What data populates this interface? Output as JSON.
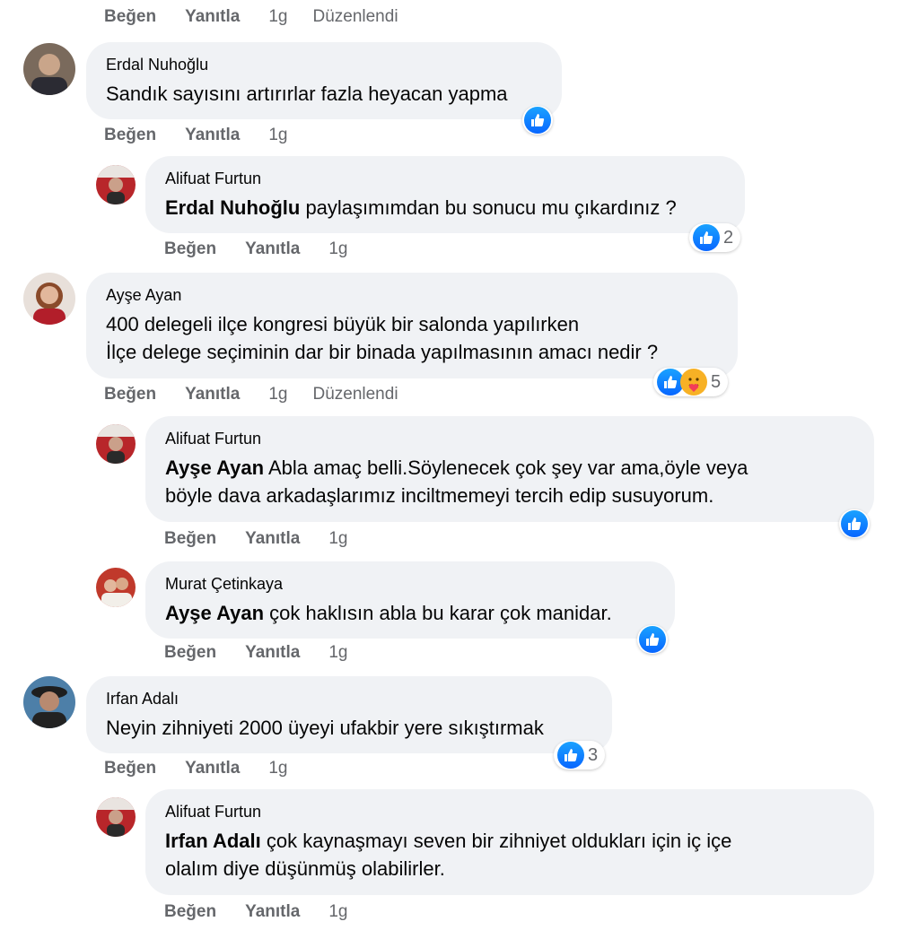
{
  "actions": {
    "like": "Beğen",
    "reply": "Yanıtla",
    "time": "1g",
    "edited": "Düzenlendi"
  },
  "comments": [
    {
      "author": "Erdal Nuhoğlu",
      "lines": [
        "Sandık sayısını artırırlar fazla heyacan yapma"
      ],
      "reaction_count": ""
    },
    {
      "author": "Alifuat Furtun",
      "mention": "Erdal Nuhoğlu",
      "lines": [
        " paylaşımımdan bu sonucu mu çıkardınız ?"
      ],
      "reaction_count": "2"
    },
    {
      "author": "Ayşe Ayan",
      "lines": [
        "400 delegeli ilçe kongresi büyük bir salonda yapılırken",
        "İlçe delege seçiminin dar bir binada yapılmasının amacı nedir ?"
      ],
      "reaction_count": "5"
    },
    {
      "author": "Alifuat Furtun",
      "mention": "Ayşe Ayan",
      "lines": [
        " Abla amaç belli.Söylenecek çok şey var ama,öyle veya",
        "böyle dava arkadaşlarımız inciltmemeyi tercih edip susuyorum."
      ],
      "reaction_count": ""
    },
    {
      "author": "Murat Çetinkaya",
      "mention": "Ayşe Ayan",
      "lines": [
        " çok haklısın abla bu karar çok manidar."
      ],
      "reaction_count": ""
    },
    {
      "author": "Irfan Adalı",
      "lines": [
        "Neyin zihniyeti 2000 üyeyi ufakbir yere sıkıştırmak"
      ],
      "reaction_count": "3"
    },
    {
      "author": "Alifuat Furtun",
      "mention": "Irfan Adalı",
      "lines": [
        " çok kaynaşmayı seven bir zihniyet oldukları için iç içe",
        "olalım diye düşünmüş olabilirler."
      ],
      "reaction_count": ""
    }
  ],
  "colors": {
    "bubble": "#f0f2f5",
    "meta": "#65676b",
    "like_blue": "#0866ff"
  },
  "icons": [
    "like-icon",
    "care-icon"
  ]
}
